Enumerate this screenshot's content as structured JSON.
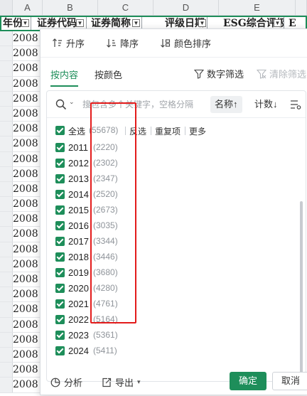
{
  "columns": [
    "A",
    "B",
    "C",
    "D",
    "E"
  ],
  "header_cells": [
    "年份",
    "证券代码",
    "证券简称",
    "评级日期",
    "ESG综合评级",
    "E"
  ],
  "sheet_year_value": "2008",
  "sort_bar": {
    "asc": "升序",
    "desc": "降序",
    "color_sort": "颜色排序"
  },
  "tabs": {
    "by_content": "按内容",
    "by_color": "按颜色",
    "number_filter": "数字筛选",
    "clear_filter": "清除筛选"
  },
  "search": {
    "placeholder": "搜包含多个关键字，空格分隔",
    "sort_name": "名称↑",
    "sort_count": "计数↓"
  },
  "select_all": {
    "label": "全选",
    "count": "(55678)",
    "invert": "反选",
    "duplicates": "重复项",
    "more": "更多"
  },
  "items": [
    {
      "label": "2011",
      "count": "(2220)"
    },
    {
      "label": "2012",
      "count": "(2302)"
    },
    {
      "label": "2013",
      "count": "(2347)"
    },
    {
      "label": "2014",
      "count": "(2520)"
    },
    {
      "label": "2015",
      "count": "(2673)"
    },
    {
      "label": "2016",
      "count": "(3035)"
    },
    {
      "label": "2017",
      "count": "(3344)"
    },
    {
      "label": "2018",
      "count": "(3446)"
    },
    {
      "label": "2019",
      "count": "(3680)"
    },
    {
      "label": "2020",
      "count": "(4280)"
    },
    {
      "label": "2021",
      "count": "(4761)"
    },
    {
      "label": "2022",
      "count": "(5164)"
    },
    {
      "label": "2023",
      "count": "(5361)"
    },
    {
      "label": "2024",
      "count": "(5411)"
    }
  ],
  "footer": {
    "analyze": "分析",
    "export": "导出",
    "ok": "确定",
    "cancel": "取消"
  },
  "colors": {
    "accent": "#1e8e5a",
    "highlight": "#e31b1b"
  }
}
